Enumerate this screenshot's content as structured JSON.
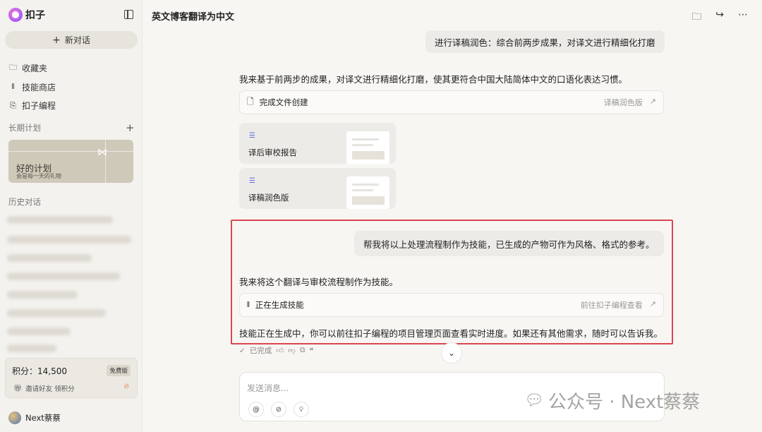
{
  "sidebar": {
    "brand": "扣子",
    "new_chat": "新对话",
    "nav": [
      {
        "label": "收藏夹",
        "icon": "folder-icon"
      },
      {
        "label": "技能商店",
        "icon": "library-icon"
      },
      {
        "label": "扣子编程",
        "icon": "code-file-icon"
      }
    ],
    "plans_title": "长期计划",
    "plan_card": {
      "title": "好的计划",
      "subtitle": "会是每一天的礼物"
    },
    "history_title": "历史对话",
    "points": {
      "label": "积分：14,500",
      "badge": "免费版",
      "invite": "邀请好友 领积分"
    },
    "user_name": "Next蔡蔡"
  },
  "header": {
    "title": "英文博客翻译为中文"
  },
  "conversation": {
    "user_msg_1": "进行译稿润色：综合前两步成果，对译文进行精细化打磨",
    "ai_msg_1": "我来基于前两步的成果，对译文进行精细化打磨，使其更符合中国大陆简体中文的口语化表达习惯。",
    "file_created": {
      "label": "完成文件创建",
      "link": "译稿润色版"
    },
    "docs": [
      {
        "label": "译后审校报告"
      },
      {
        "label": "译稿润色版"
      }
    ],
    "user_msg_2": "帮我将以上处理流程制作为技能，已生成的产物可作为风格、格式的参考。",
    "ai_msg_2": "我来将这个翻译与审校流程制作为技能。",
    "skill_row": {
      "label": "正在生成技能",
      "link": "前往扣子编程查看"
    },
    "ai_msg_3": "技能正在生成中，你可以前往扣子编程的项目管理页面查看实时进度。如果还有其他需求，随时可以告诉我。",
    "status": "已完成"
  },
  "composer": {
    "placeholder": "发送消息..."
  },
  "watermark": "公众号 · Next蔡蔡",
  "colors": {
    "highlight": "#d9474f",
    "doc_icon": "#5b6bdc"
  }
}
